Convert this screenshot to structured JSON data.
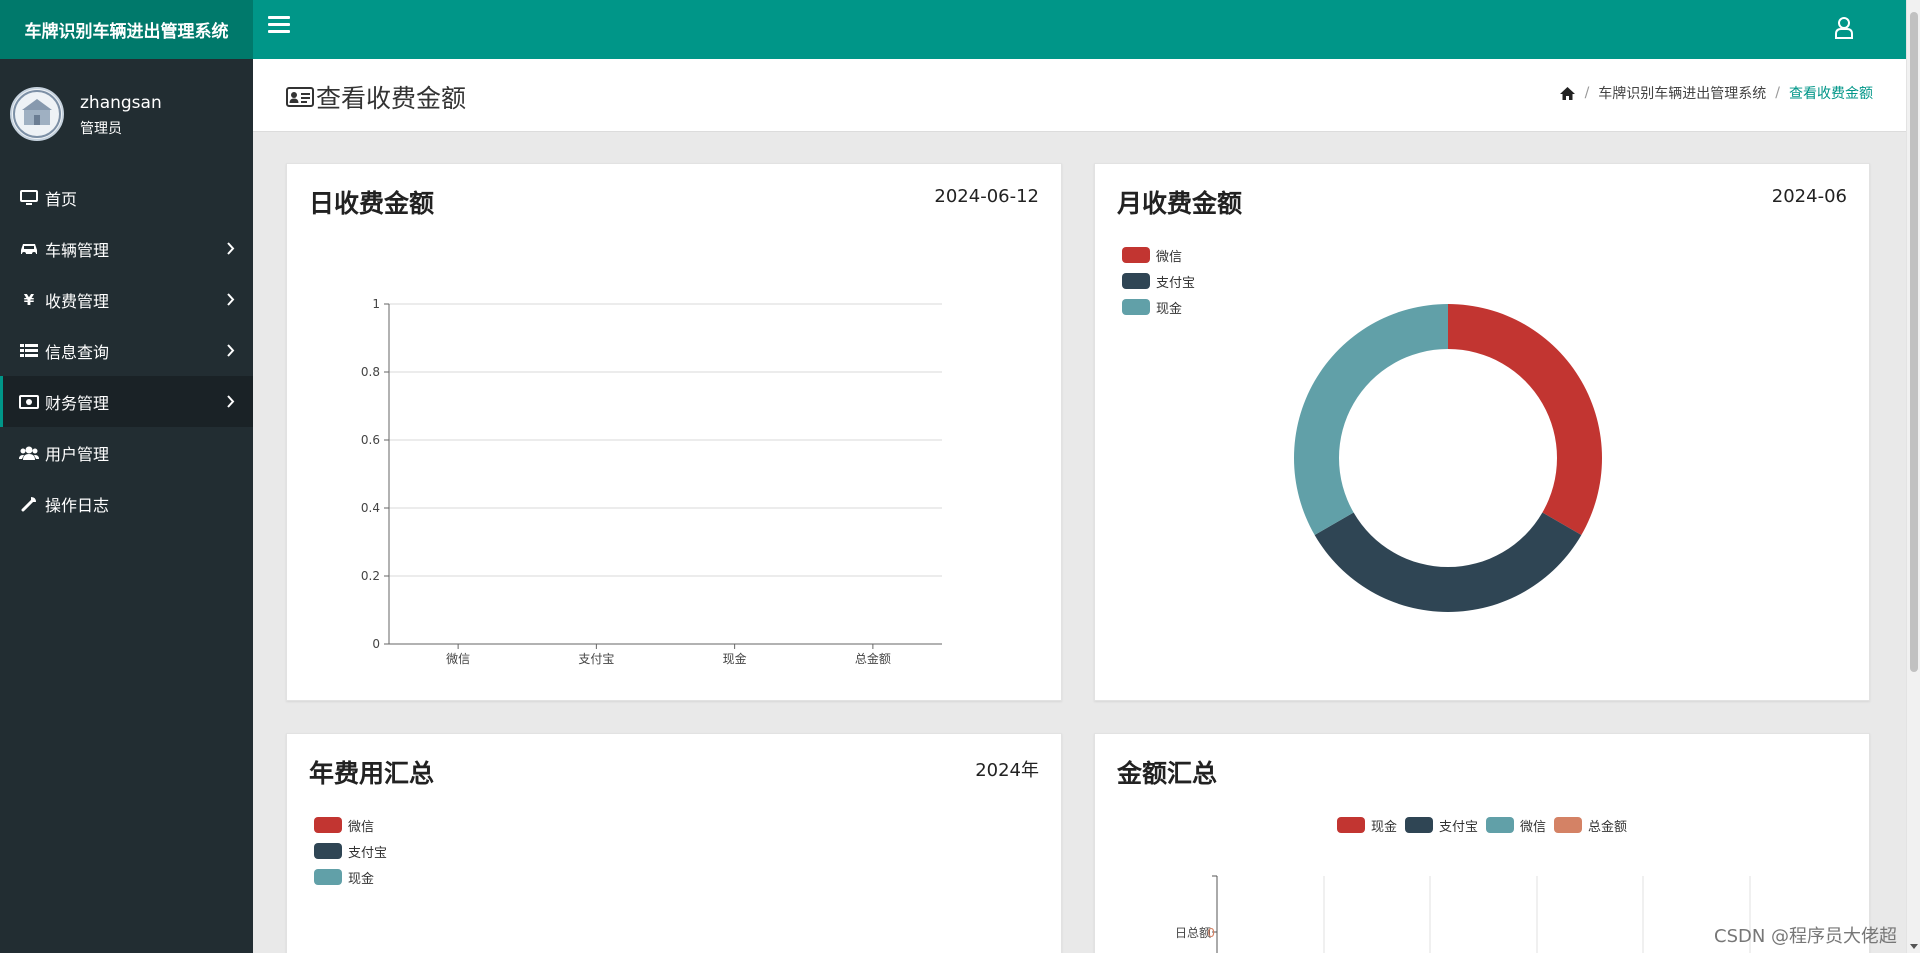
{
  "app": {
    "title": "车牌识别车辆进出管理系统"
  },
  "user": {
    "name": "zhangsan",
    "role": "管理员"
  },
  "sidebar": {
    "items": [
      {
        "label": "首页",
        "icon": "monitor-icon",
        "has_children": false
      },
      {
        "label": "车辆管理",
        "icon": "car-icon",
        "has_children": true
      },
      {
        "label": "收费管理",
        "icon": "yen-icon",
        "has_children": true
      },
      {
        "label": "信息查询",
        "icon": "list-icon",
        "has_children": true
      },
      {
        "label": "财务管理",
        "icon": "money-icon",
        "has_children": true,
        "active": true
      },
      {
        "label": "用户管理",
        "icon": "users-icon",
        "has_children": false
      },
      {
        "label": "操作日志",
        "icon": "wrench-icon",
        "has_children": false
      }
    ]
  },
  "header": {
    "page_title": "查看收费金额",
    "breadcrumb": [
      "车牌识别车辆进出管理系统",
      "查看收费金额"
    ]
  },
  "colors": {
    "accent": "#009688",
    "sidebar": "#222d32",
    "wechat": "#c23531",
    "alipay": "#2f4554",
    "cash": "#61a0a8",
    "total": "#d48265"
  },
  "cards": {
    "daily": {
      "title": "日收费金额",
      "date": "2024-06-12"
    },
    "monthly": {
      "title": "月收费金额",
      "date": "2024-06"
    },
    "yearly": {
      "title": "年费用汇总",
      "date": "2024年"
    },
    "summary": {
      "title": "金额汇总"
    }
  },
  "chart_data": [
    {
      "type": "bar",
      "title": "日收费金额",
      "categories": [
        "微信",
        "支付宝",
        "现金",
        "总金额"
      ],
      "values": [
        0,
        0,
        0,
        0
      ],
      "ylim": [
        0,
        1
      ],
      "yticks": [
        "0",
        "0.2",
        "0.4",
        "0.6",
        "0.8",
        "1"
      ],
      "grid": true
    },
    {
      "type": "pie",
      "title": "月收费金额",
      "legend": [
        "微信",
        "支付宝",
        "现金"
      ],
      "legend_position": "top-left",
      "slices": [
        {
          "name": "微信",
          "value": 1
        },
        {
          "name": "支付宝",
          "value": 1
        },
        {
          "name": "现金",
          "value": 1
        }
      ],
      "donut": true
    },
    {
      "type": "pie",
      "title": "年费用汇总",
      "legend": [
        "微信",
        "支付宝",
        "现金"
      ],
      "legend_position": "top-left"
    },
    {
      "type": "bar",
      "title": "金额汇总",
      "legend": [
        "现金",
        "支付宝",
        "微信",
        "总金额"
      ],
      "legend_position": "top-center",
      "orientation": "horizontal",
      "categories": [
        "日总额"
      ],
      "values": [
        0
      ],
      "value_label": "0"
    }
  ],
  "watermark": "CSDN @程序员大佬超"
}
